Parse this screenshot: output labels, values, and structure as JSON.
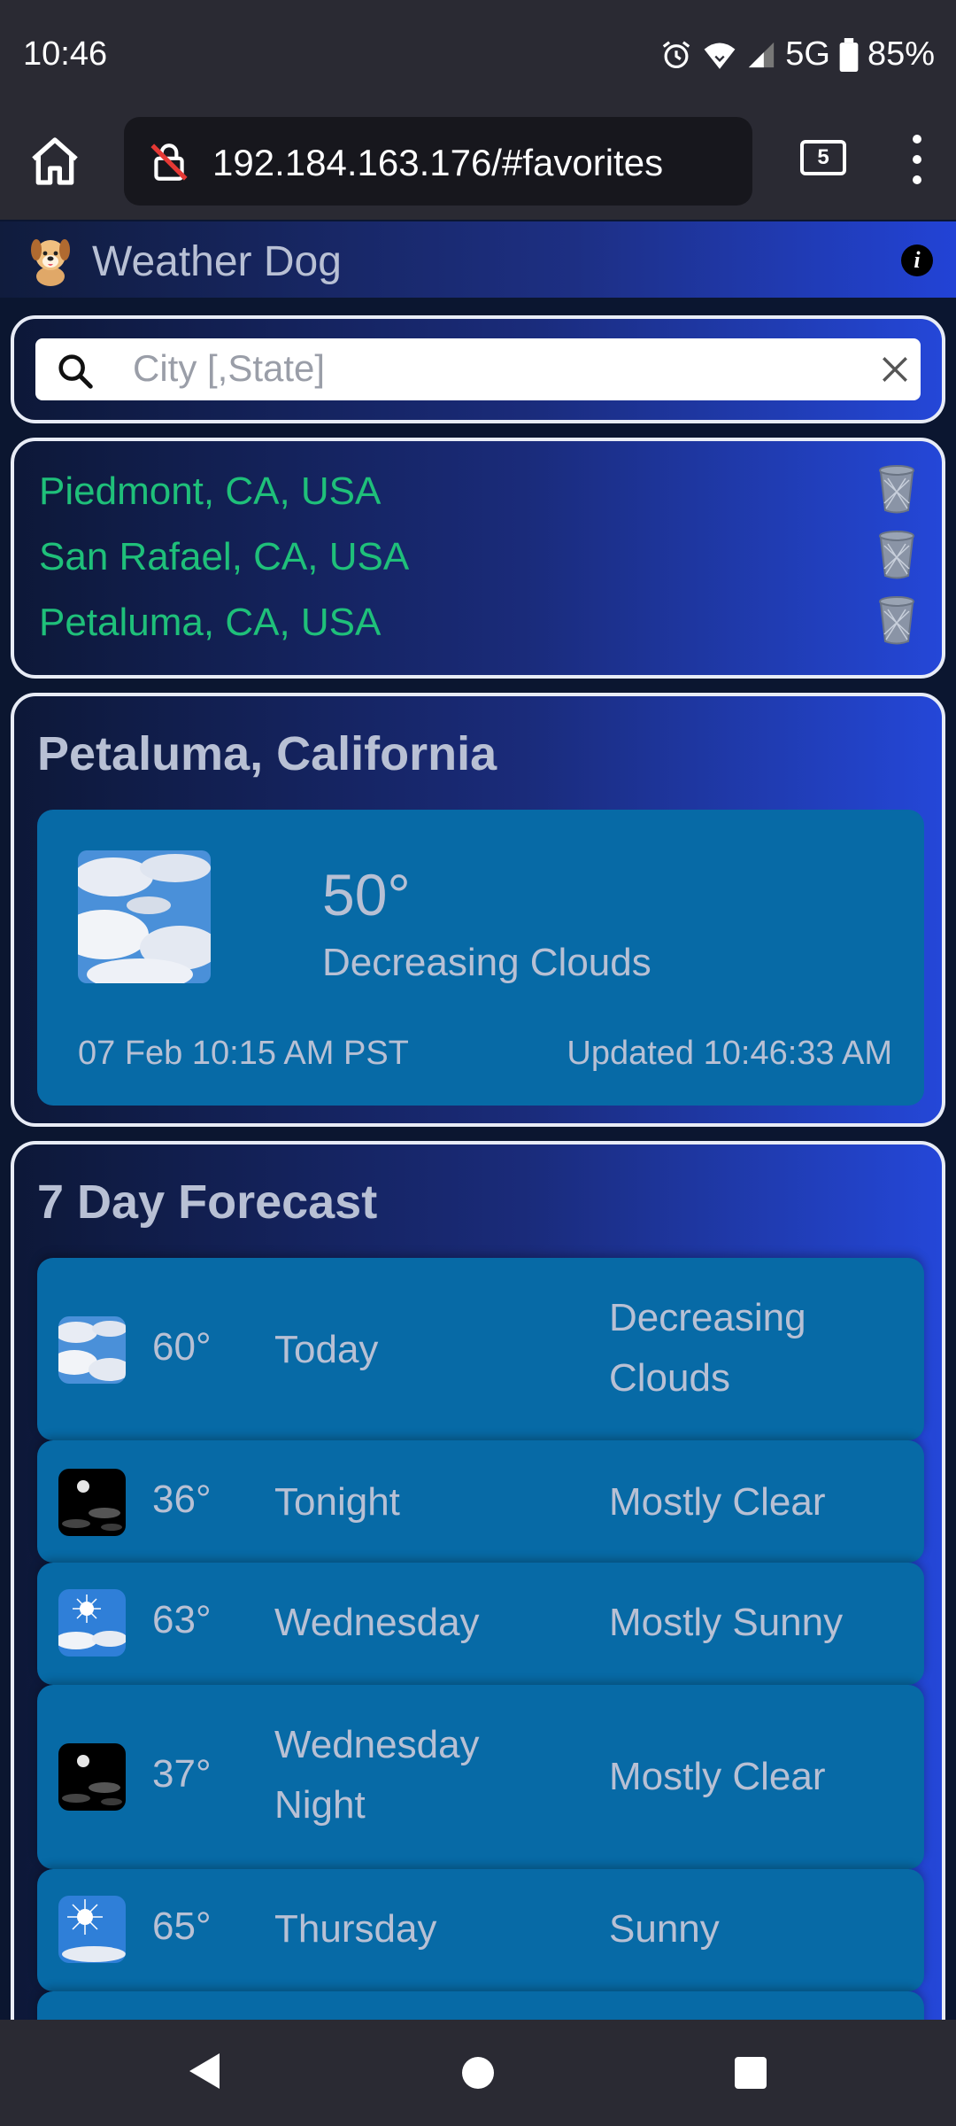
{
  "status_bar": {
    "time": "10:46",
    "network": "5G",
    "battery": "85%",
    "icons": [
      "alarm-icon",
      "wifi-icon",
      "signal-icon",
      "battery-icon"
    ]
  },
  "browser": {
    "url": "192.184.163.176/#favorites",
    "tab_count": "5",
    "icons": [
      "home-icon",
      "not-secure-lock-icon",
      "overflow-menu-icon"
    ]
  },
  "app": {
    "title": "Weather Dog",
    "logo_icon": "dog-logo-icon",
    "info_icon": "info-icon",
    "info_glyph": "i"
  },
  "search": {
    "placeholder": "City [,State]",
    "value": ""
  },
  "favorites": [
    {
      "label": "Piedmont, CA, USA"
    },
    {
      "label": "San Rafael, CA, USA"
    },
    {
      "label": "Petaluma, CA, USA"
    }
  ],
  "current": {
    "location": "Petaluma, California",
    "temp": "50°",
    "condition": "Decreasing Clouds",
    "observed": "07 Feb 10:15 AM PST",
    "updated": "Updated 10:46:33 AM",
    "icon": "clouds-icon"
  },
  "forecast": {
    "title": "7 Day Forecast",
    "days": [
      {
        "temp": "60°",
        "day": "Today",
        "condition": "Decreasing Clouds",
        "icon": "clouds-icon"
      },
      {
        "temp": "36°",
        "day": "Tonight",
        "condition": "Mostly Clear",
        "icon": "night-clear-icon"
      },
      {
        "temp": "63°",
        "day": "Wednesday",
        "condition": "Mostly Sunny",
        "icon": "mostly-sunny-icon"
      },
      {
        "temp": "37°",
        "day": "Wednesday Night",
        "condition": "Mostly Clear",
        "icon": "night-clear-icon"
      },
      {
        "temp": "65°",
        "day": "Thursday",
        "condition": "Sunny",
        "icon": "sunny-icon"
      }
    ]
  },
  "colors": {
    "favorite_link": "#1fc07a",
    "panel": "#076aa6",
    "header_gradient_end": "#2243d6"
  }
}
